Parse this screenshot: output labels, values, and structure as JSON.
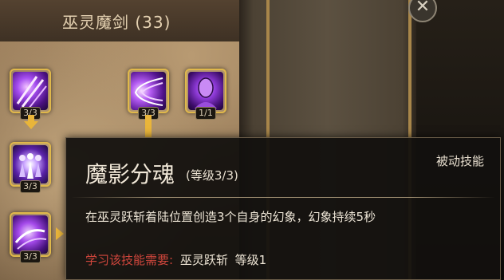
{
  "tree": {
    "title": "巫灵魔剑 (33)",
    "skills": [
      {
        "name": "purple-claw-skill",
        "rank": "3/3"
      },
      {
        "name": "purple-slash-skill",
        "rank": "3/3"
      },
      {
        "name": "purple-head-skill",
        "rank": "1/1"
      },
      {
        "name": "shadow-clone-skill",
        "rank": "3/3"
      },
      {
        "name": "purple-strike-skill",
        "rank": "3/3"
      }
    ]
  },
  "close": {
    "label": "✕"
  },
  "tooltip": {
    "name": "魔影分魂",
    "level": "(等级3/3)",
    "type": "被动技能",
    "description": "在巫灵跃斩着陆位置创造3个自身的幻象，幻象持续5秒",
    "requirement_label": "学习该技能需要:",
    "requirement_skill": "巫灵跃斩",
    "requirement_level": "等级1"
  },
  "colors": {
    "accent_gold": "#e0b84a",
    "requirement_red": "#d0463c",
    "skill_purple": "#7a2fd0"
  }
}
